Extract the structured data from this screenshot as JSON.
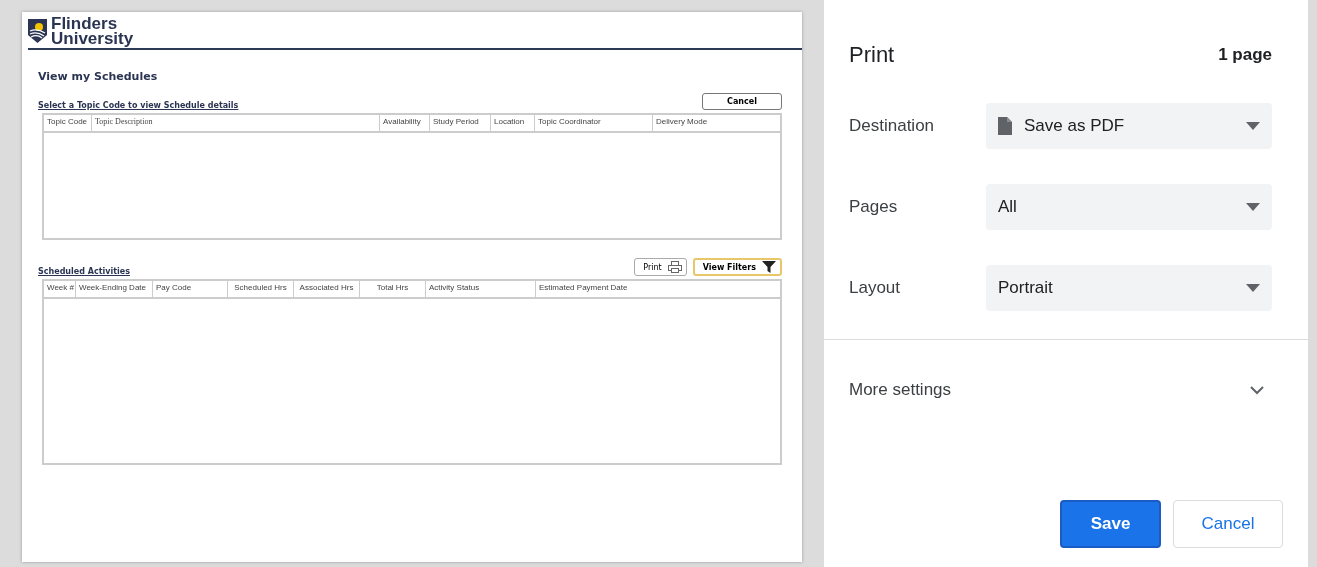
{
  "preview": {
    "logo": {
      "line1": "Flinders",
      "line2": "University"
    },
    "title": "View my Schedules",
    "topics": {
      "link": "Select a Topic Code to view Schedule details",
      "cancel": "Cancel",
      "columns": [
        "Topic Code",
        "Topic Description",
        "Availability",
        "Study Period",
        "Location",
        "Topic Coordinator",
        "Delivery Mode"
      ]
    },
    "activities": {
      "link": "Scheduled Activities",
      "print": "Print",
      "filters": "View Filters",
      "columns": [
        "Week #",
        "Week-Ending Date",
        "Pay Code",
        "Scheduled Hrs",
        "Associated Hrs",
        "Total Hrs",
        "Activity Status",
        "Estimated Payment Date"
      ]
    }
  },
  "print_panel": {
    "title": "Print",
    "page_count": "1 page",
    "settings": [
      {
        "label": "Destination",
        "value": "Save as PDF",
        "kind": "file"
      },
      {
        "label": "Pages",
        "value": "All",
        "kind": "plain"
      },
      {
        "label": "Layout",
        "value": "Portrait",
        "kind": "plain"
      }
    ],
    "more_settings": {
      "label": "More settings",
      "expanded": false
    },
    "buttons": [
      {
        "label": "Save",
        "kind": "primary"
      },
      {
        "label": "Cancel",
        "kind": "secondary"
      }
    ]
  }
}
